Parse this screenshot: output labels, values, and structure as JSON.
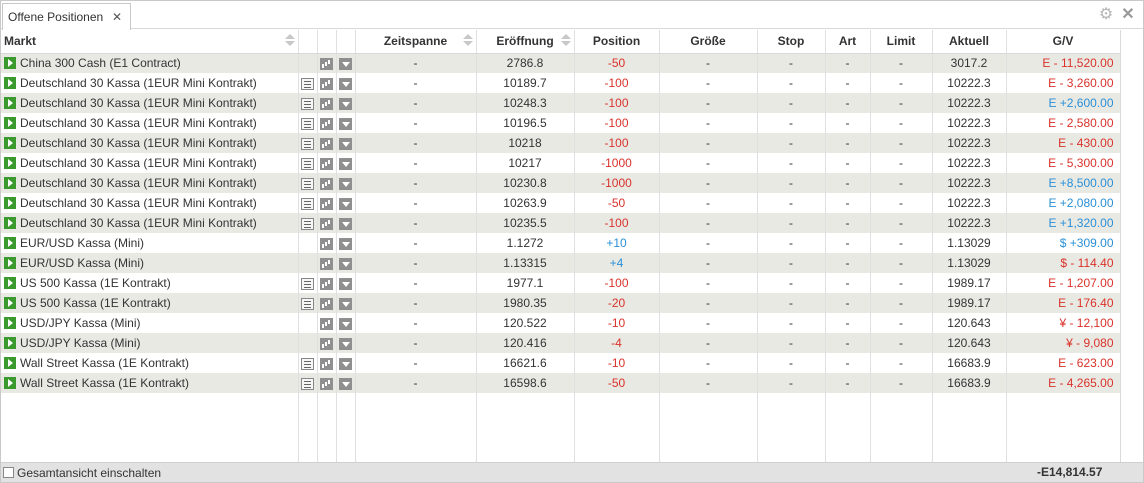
{
  "tab": {
    "label": "Offene Positionen",
    "close": "✕"
  },
  "window_controls": {
    "gear": "⚙",
    "close": "✕"
  },
  "columns": {
    "markt": "Markt",
    "zeitspanne": "Zeitspanne",
    "eroeffnung": "Eröffnung",
    "position": "Position",
    "groesse": "Größe",
    "stop": "Stop",
    "art": "Art",
    "limit": "Limit",
    "aktuell": "Aktuell",
    "gv": "G/V"
  },
  "rows": [
    {
      "markt": "China 300 Cash (E1 Contract)",
      "doc": false,
      "zeitspanne": "-",
      "eroeffnung": "2786.8",
      "position": "-50",
      "pos_color": "red",
      "groesse": "-",
      "stop": "-",
      "art": "-",
      "limit": "-",
      "aktuell": "3017.2",
      "gv": "E - 11,520.00",
      "gv_color": "red"
    },
    {
      "markt": "Deutschland 30 Kassa (1EUR Mini Kontrakt)",
      "doc": true,
      "zeitspanne": "-",
      "eroeffnung": "10189.7",
      "position": "-100",
      "pos_color": "red",
      "groesse": "-",
      "stop": "-",
      "art": "-",
      "limit": "-",
      "aktuell": "10222.3",
      "gv": "E - 3,260.00",
      "gv_color": "red"
    },
    {
      "markt": "Deutschland 30 Kassa (1EUR Mini Kontrakt)",
      "doc": true,
      "zeitspanne": "-",
      "eroeffnung": "10248.3",
      "position": "-100",
      "pos_color": "red",
      "groesse": "-",
      "stop": "-",
      "art": "-",
      "limit": "-",
      "aktuell": "10222.3",
      "gv": "E +2,600.00",
      "gv_color": "blue"
    },
    {
      "markt": "Deutschland 30 Kassa (1EUR Mini Kontrakt)",
      "doc": true,
      "zeitspanne": "-",
      "eroeffnung": "10196.5",
      "position": "-100",
      "pos_color": "red",
      "groesse": "-",
      "stop": "-",
      "art": "-",
      "limit": "-",
      "aktuell": "10222.3",
      "gv": "E - 2,580.00",
      "gv_color": "red"
    },
    {
      "markt": "Deutschland 30 Kassa (1EUR Mini Kontrakt)",
      "doc": true,
      "zeitspanne": "-",
      "eroeffnung": "10218",
      "position": "-100",
      "pos_color": "red",
      "groesse": "-",
      "stop": "-",
      "art": "-",
      "limit": "-",
      "aktuell": "10222.3",
      "gv": "E - 430.00",
      "gv_color": "red"
    },
    {
      "markt": "Deutschland 30 Kassa (1EUR Mini Kontrakt)",
      "doc": true,
      "zeitspanne": "-",
      "eroeffnung": "10217",
      "position": "-1000",
      "pos_color": "red",
      "groesse": "-",
      "stop": "-",
      "art": "-",
      "limit": "-",
      "aktuell": "10222.3",
      "gv": "E - 5,300.00",
      "gv_color": "red"
    },
    {
      "markt": "Deutschland 30 Kassa (1EUR Mini Kontrakt)",
      "doc": true,
      "zeitspanne": "-",
      "eroeffnung": "10230.8",
      "position": "-1000",
      "pos_color": "red",
      "groesse": "-",
      "stop": "-",
      "art": "-",
      "limit": "-",
      "aktuell": "10222.3",
      "gv": "E +8,500.00",
      "gv_color": "blue"
    },
    {
      "markt": "Deutschland 30 Kassa (1EUR Mini Kontrakt)",
      "doc": true,
      "zeitspanne": "-",
      "eroeffnung": "10263.9",
      "position": "-50",
      "pos_color": "red",
      "groesse": "-",
      "stop": "-",
      "art": "-",
      "limit": "-",
      "aktuell": "10222.3",
      "gv": "E +2,080.00",
      "gv_color": "blue"
    },
    {
      "markt": "Deutschland 30 Kassa (1EUR Mini Kontrakt)",
      "doc": true,
      "zeitspanne": "-",
      "eroeffnung": "10235.5",
      "position": "-100",
      "pos_color": "red",
      "groesse": "-",
      "stop": "-",
      "art": "-",
      "limit": "-",
      "aktuell": "10222.3",
      "gv": "E +1,320.00",
      "gv_color": "blue"
    },
    {
      "markt": "EUR/USD Kassa (Mini)",
      "doc": false,
      "zeitspanne": "-",
      "eroeffnung": "1.1272",
      "position": "+10",
      "pos_color": "blue",
      "groesse": "-",
      "stop": "-",
      "art": "-",
      "limit": "-",
      "aktuell": "1.13029",
      "gv": "$ +309.00",
      "gv_color": "blue"
    },
    {
      "markt": "EUR/USD Kassa (Mini)",
      "doc": false,
      "zeitspanne": "-",
      "eroeffnung": "1.13315",
      "position": "+4",
      "pos_color": "blue",
      "groesse": "-",
      "stop": "-",
      "art": "-",
      "limit": "-",
      "aktuell": "1.13029",
      "gv": "$ - 114.40",
      "gv_color": "red"
    },
    {
      "markt": "US 500 Kassa (1E Kontrakt)",
      "doc": true,
      "zeitspanne": "-",
      "eroeffnung": "1977.1",
      "position": "-100",
      "pos_color": "red",
      "groesse": "-",
      "stop": "-",
      "art": "-",
      "limit": "-",
      "aktuell": "1989.17",
      "gv": "E - 1,207.00",
      "gv_color": "red"
    },
    {
      "markt": "US 500 Kassa (1E Kontrakt)",
      "doc": true,
      "zeitspanne": "-",
      "eroeffnung": "1980.35",
      "position": "-20",
      "pos_color": "red",
      "groesse": "-",
      "stop": "-",
      "art": "-",
      "limit": "-",
      "aktuell": "1989.17",
      "gv": "E - 176.40",
      "gv_color": "red"
    },
    {
      "markt": "USD/JPY Kassa (Mini)",
      "doc": false,
      "zeitspanne": "-",
      "eroeffnung": "120.522",
      "position": "-10",
      "pos_color": "red",
      "groesse": "-",
      "stop": "-",
      "art": "-",
      "limit": "-",
      "aktuell": "120.643",
      "gv": "¥ - 12,100",
      "gv_color": "red"
    },
    {
      "markt": "USD/JPY Kassa (Mini)",
      "doc": false,
      "zeitspanne": "-",
      "eroeffnung": "120.416",
      "position": "-4",
      "pos_color": "red",
      "groesse": "-",
      "stop": "-",
      "art": "-",
      "limit": "-",
      "aktuell": "120.643",
      "gv": "¥ - 9,080",
      "gv_color": "red"
    },
    {
      "markt": "Wall Street Kassa (1E Kontrakt)",
      "doc": true,
      "zeitspanne": "-",
      "eroeffnung": "16621.6",
      "position": "-10",
      "pos_color": "red",
      "groesse": "-",
      "stop": "-",
      "art": "-",
      "limit": "-",
      "aktuell": "16683.9",
      "gv": "E - 623.00",
      "gv_color": "red"
    },
    {
      "markt": "Wall Street Kassa (1E Kontrakt)",
      "doc": true,
      "zeitspanne": "-",
      "eroeffnung": "16598.6",
      "position": "-50",
      "pos_color": "red",
      "groesse": "-",
      "stop": "-",
      "art": "-",
      "limit": "-",
      "aktuell": "16683.9",
      "gv": "E - 4,265.00",
      "gv_color": "red"
    }
  ],
  "footer": {
    "checkbox_label": "Gesamtansicht einschalten",
    "total": "-E14,814.57"
  }
}
